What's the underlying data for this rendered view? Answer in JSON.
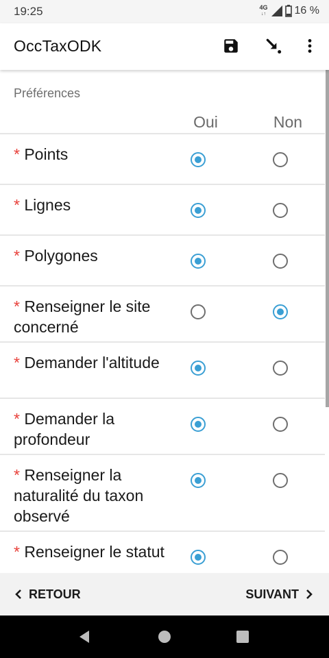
{
  "status": {
    "time": "19:25",
    "network": "4G",
    "battery": "16 %"
  },
  "appbar": {
    "title": "OccTaxODK",
    "icons": [
      "save-icon",
      "jump-icon",
      "more-vert-icon"
    ]
  },
  "section_title": "Préférences",
  "columns": {
    "yes": "Oui",
    "no": "Non"
  },
  "required_marker": "*",
  "rows": [
    {
      "label": "Points",
      "value": "Oui"
    },
    {
      "label": "Lignes",
      "value": "Oui"
    },
    {
      "label": "Polygones",
      "value": "Oui"
    },
    {
      "label": "Renseigner le site concerné",
      "value": "Non"
    },
    {
      "label": "Demander l'altitude",
      "value": "Oui"
    },
    {
      "label": "Demander la profondeur",
      "value": "Oui"
    },
    {
      "label": "Renseigner la naturalité du taxon observé",
      "value": "Oui"
    },
    {
      "label": "Renseigner le statut",
      "value": "Oui"
    }
  ],
  "footer": {
    "back": "RETOUR",
    "next": "SUIVANT"
  },
  "colors": {
    "accent": "#3a9fd4",
    "required": "#e8403a"
  }
}
